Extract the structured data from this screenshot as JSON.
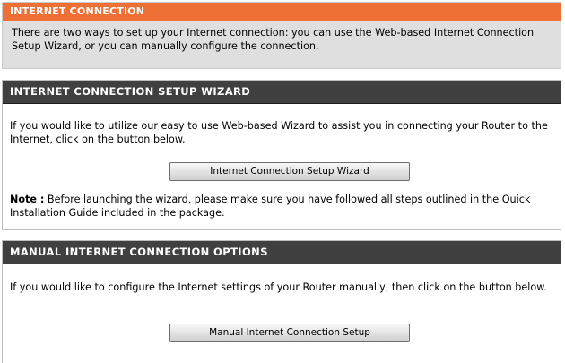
{
  "internet_connection": {
    "title": "INTERNET CONNECTION",
    "description": "There are two ways to set up your Internet connection: you can use the Web-based Internet Connection Setup Wizard, or you can manually configure the connection."
  },
  "setup_wizard": {
    "title": "INTERNET CONNECTION SETUP WIZARD",
    "description": "If you would like to utilize our easy to use Web-based Wizard to assist you in connecting your Router to the Internet, click on the button below.",
    "button_label": "Internet Connection Setup Wizard",
    "note_label": "Note :",
    "note_text": " Before launching the wizard, please make sure you have followed all steps outlined in the Quick Installation Guide included in the package."
  },
  "manual_options": {
    "title": "MANUAL INTERNET CONNECTION OPTIONS",
    "description": "If you would like to configure the Internet settings of your Router manually, then click on the button below.",
    "button_label": "Manual Internet Connection Setup"
  },
  "colors": {
    "orange_header": "#ee7034",
    "dark_header": "#404040",
    "intro_background": "#dfdfdf"
  }
}
